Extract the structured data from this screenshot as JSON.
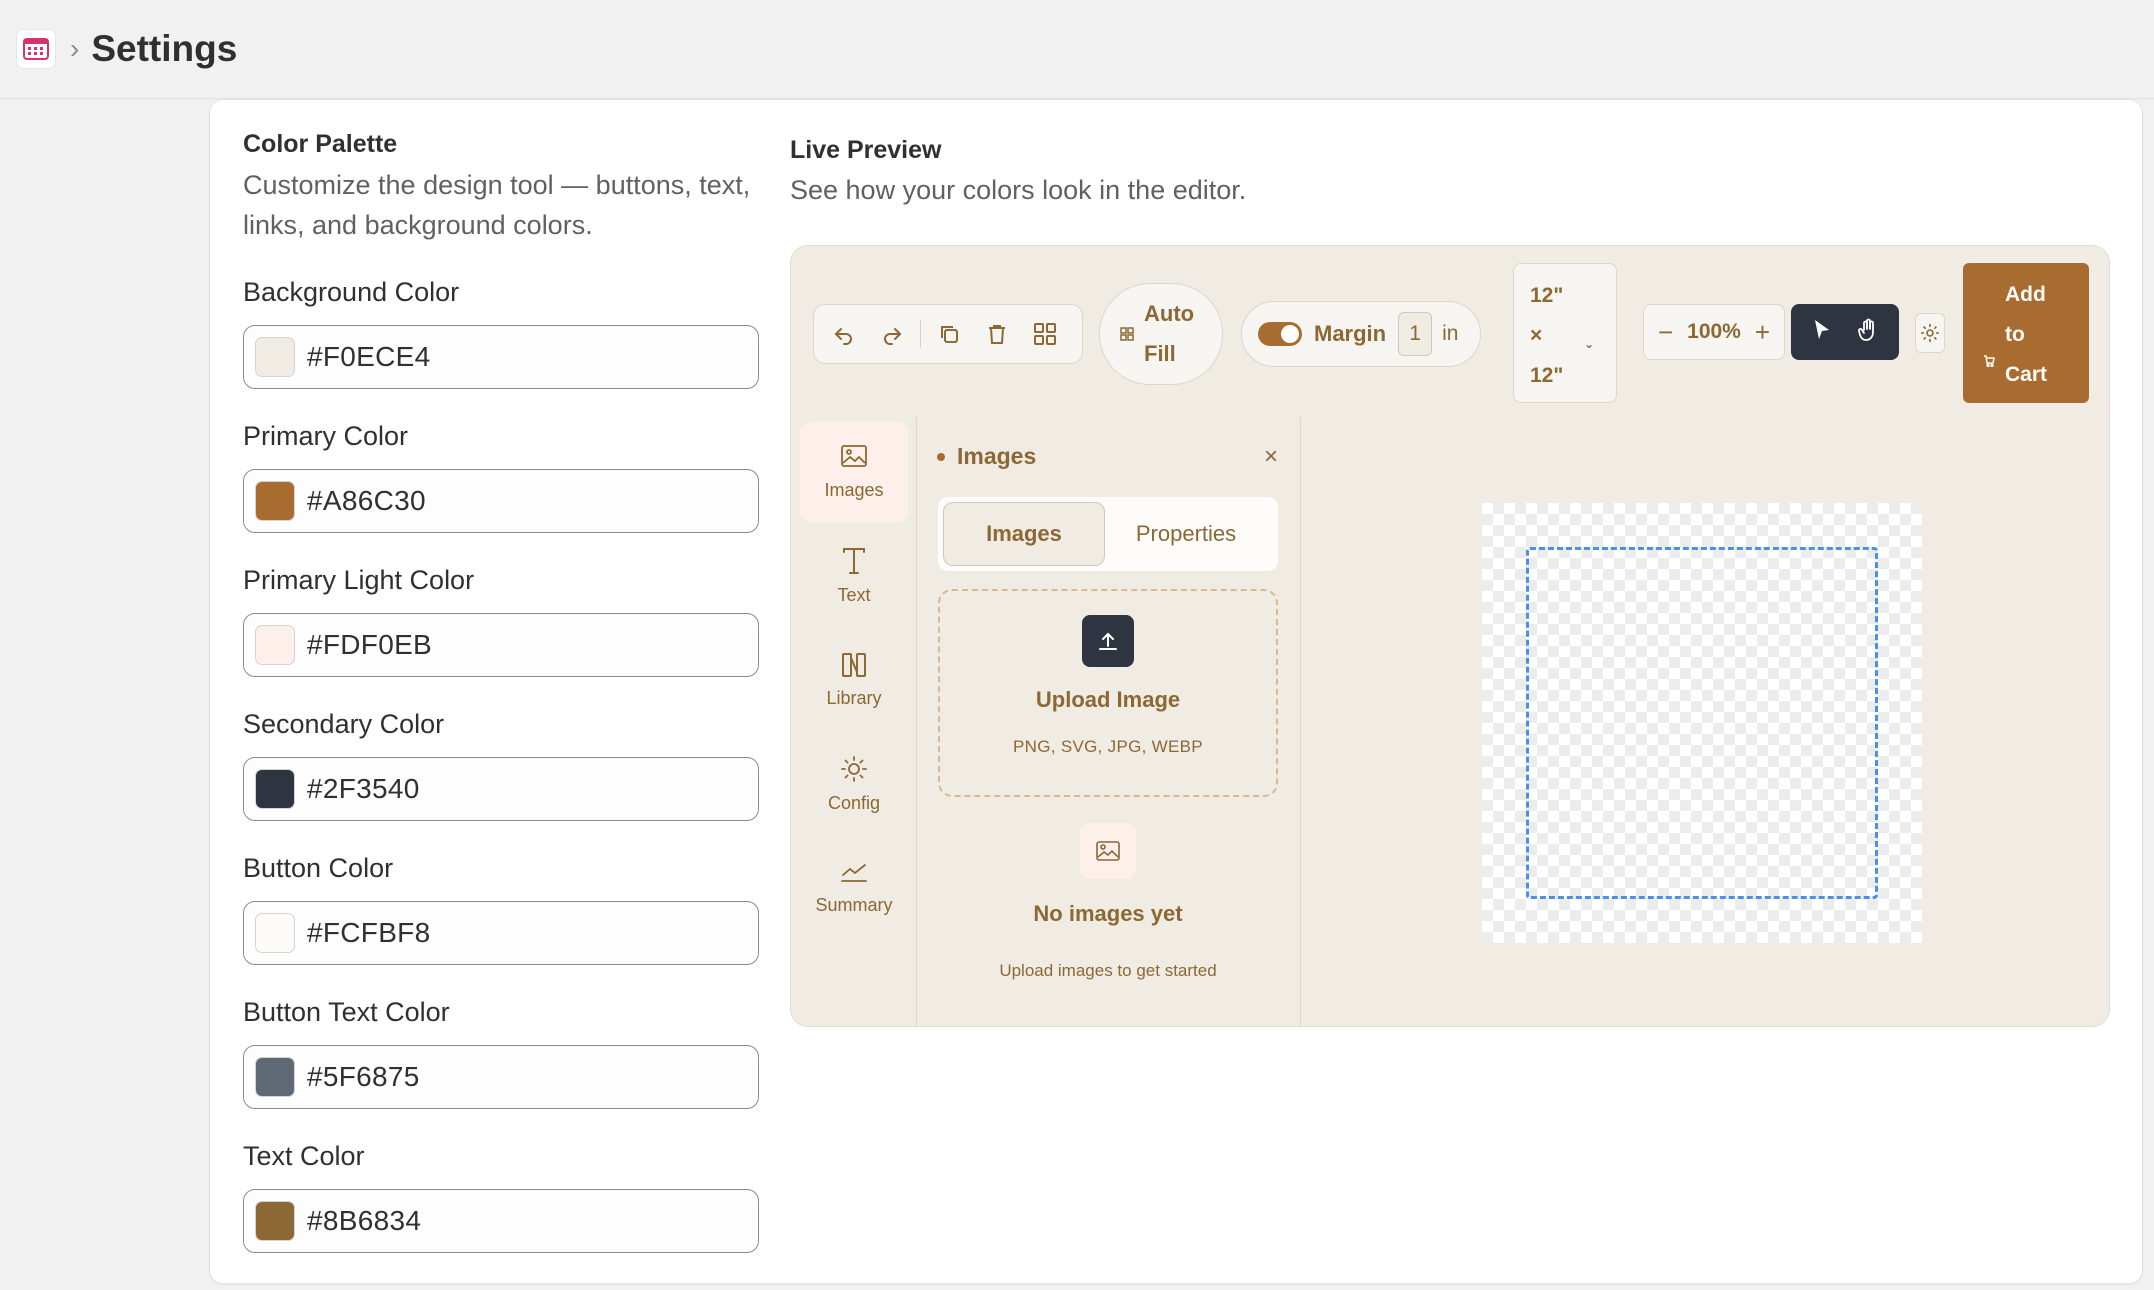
{
  "header": {
    "title": "Settings",
    "app_icon": "app-grid-icon",
    "separator": "›"
  },
  "palette": {
    "title": "Color Palette",
    "description": "Customize the design tool — buttons, text, links, and background colors.",
    "fields": [
      {
        "label": "Background Color",
        "value": "#F0ECE4",
        "color": "#F0ECE4"
      },
      {
        "label": "Primary Color",
        "value": "#A86C30",
        "color": "#A86C30"
      },
      {
        "label": "Primary Light Color",
        "value": "#FDF0EB",
        "color": "#FDF0EB"
      },
      {
        "label": "Secondary Color",
        "value": "#2F3540",
        "color": "#2F3540"
      },
      {
        "label": "Button Color",
        "value": "#FCFBF8",
        "color": "#FCFBF8"
      },
      {
        "label": "Button Text Color",
        "value": "#5F6875",
        "color": "#5F6875"
      },
      {
        "label": "Text Color",
        "value": "#8B6834",
        "color": "#8B6834"
      }
    ]
  },
  "preview": {
    "title": "Live Preview",
    "description": "See how your colors look in the editor.",
    "toolbar": {
      "auto_fill": [
        "Auto",
        "Fill"
      ],
      "margin_label": "Margin",
      "margin_value": "1",
      "margin_unit": "in",
      "size": [
        "12\"",
        "×",
        "12\""
      ],
      "zoom_minus": "−",
      "zoom": "100%",
      "zoom_plus": "+",
      "add_to_cart": [
        "Add",
        "to",
        "Cart"
      ],
      "margin_enabled": true
    },
    "nav": [
      {
        "label": "Images",
        "icon": "image-icon",
        "active": true
      },
      {
        "label": "Text",
        "icon": "text-icon",
        "active": false
      },
      {
        "label": "Library",
        "icon": "library-icon",
        "active": false
      },
      {
        "label": "Config",
        "icon": "sun-icon",
        "active": false
      },
      {
        "label": "Summary",
        "icon": "chart-icon",
        "active": false
      }
    ],
    "panel": {
      "title": "Images",
      "close": "×",
      "tabs": [
        "Images",
        "Properties"
      ],
      "active_tab": "Images",
      "upload_title": "Upload Image",
      "upload_hint": "PNG, SVG, JPG, WEBP",
      "empty_title": "No images yet",
      "empty_hint": "Upload images to get started"
    }
  }
}
